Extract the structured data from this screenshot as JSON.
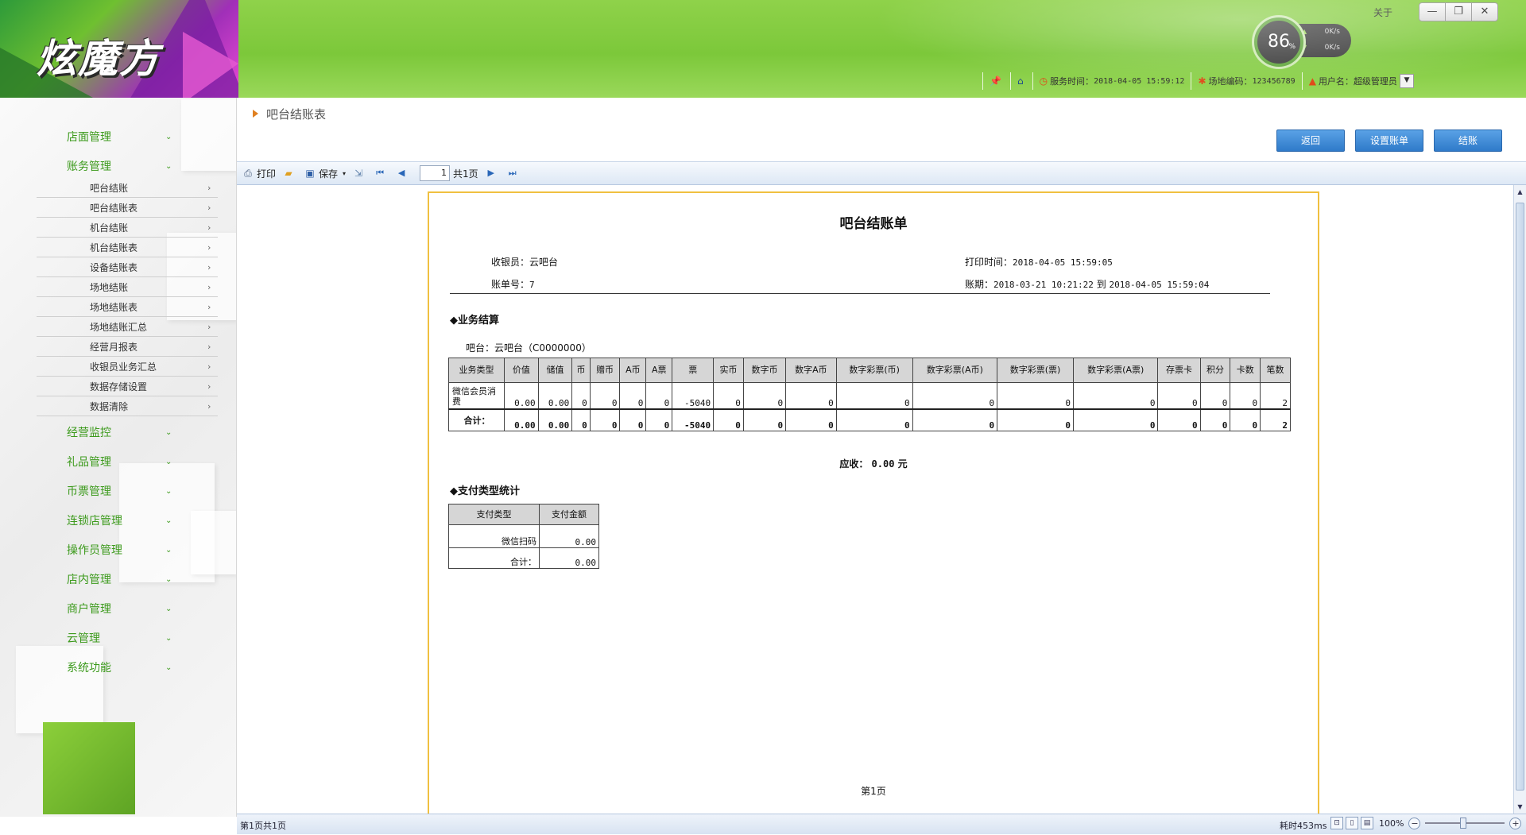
{
  "header": {
    "logo_text": "炫魔方",
    "gauge_value": "86",
    "gauge_unit": "%",
    "upload_speed": "0K/s",
    "download_speed": "0K/s",
    "about_label": "关于",
    "window_buttons": [
      "—",
      "❐",
      "✕"
    ],
    "service_time_label": "服务时间：",
    "service_time": "2018-04-05 15:59:12",
    "venue_code_label": "场地编码：",
    "venue_code": "123456789",
    "username_label": "用户名：",
    "username": "超级管理员"
  },
  "sidebar": {
    "menu": [
      {
        "label": "店面管理"
      },
      {
        "label": "账务管理"
      },
      {
        "label": "经营监控"
      },
      {
        "label": "礼品管理"
      },
      {
        "label": "币票管理"
      },
      {
        "label": "连锁店管理"
      },
      {
        "label": "操作员管理"
      },
      {
        "label": "店内管理"
      },
      {
        "label": "商户管理"
      },
      {
        "label": "云管理"
      },
      {
        "label": "系统功能"
      }
    ],
    "sub_items": [
      "吧台结账",
      "吧台结账表",
      "机台结账",
      "机台结账表",
      "设备结账表",
      "场地结账",
      "场地结账表",
      "场地结账汇总",
      "经营月报表",
      "收银员业务汇总",
      "数据存储设置",
      "数据清除"
    ]
  },
  "main": {
    "breadcrumb": "吧台结账表",
    "buttons": {
      "back": "返回",
      "set_account": "设置账单",
      "checkout": "结账"
    }
  },
  "toolbar": {
    "print": "打印",
    "save": "保存",
    "page_value": "1",
    "page_total": "共1页"
  },
  "report": {
    "title": "吧台结账单",
    "cashier_label": "收银员：",
    "cashier": "云吧台",
    "print_time_label": "打印时间：",
    "print_time": "2018-04-05 15:59:05",
    "bill_no_label": "账单号：",
    "bill_no": "7",
    "period_label": "账期：",
    "period_start": "2018-03-21 10:21:22",
    "period_to": "到",
    "period_end": "2018-04-05 15:59:04",
    "section1": "◆业务结算",
    "bar_line": "吧台：云吧台（C0000000）",
    "biz_headers": [
      "业务类型",
      "价值",
      "储值",
      "币",
      "赠币",
      "A币",
      "A票",
      "票",
      "实币",
      "数字币",
      "数字A币",
      "数字彩票(币)",
      "数字彩票(A币)",
      "数字彩票(票)",
      "数字彩票(A票)",
      "存票卡",
      "积分",
      "卡数",
      "笔数"
    ],
    "biz_rows": [
      [
        "微信会员消费",
        "0.00",
        "0.00",
        "0",
        "0",
        "0",
        "0",
        "-5040",
        "0",
        "0",
        "0",
        "0",
        "0",
        "0",
        "0",
        "0",
        "0",
        "0",
        "2"
      ]
    ],
    "biz_total": [
      "合计：",
      "0.00",
      "0.00",
      "0",
      "0",
      "0",
      "0",
      "-5040",
      "0",
      "0",
      "0",
      "0",
      "0",
      "0",
      "0",
      "0",
      "0",
      "0",
      "2"
    ],
    "receivable_label": "应收：",
    "receivable_value": "0.00",
    "receivable_unit": "元",
    "section2": "◆支付类型统计",
    "pay_headers": [
      "支付类型",
      "支付金额"
    ],
    "pay_rows": [
      [
        "微信扫码",
        "0.00"
      ]
    ],
    "pay_total": [
      "合计：",
      "0.00"
    ],
    "page_footer": "第1页"
  },
  "statusbar": {
    "page_info": "第1页共1页",
    "elapsed": "耗时453ms",
    "zoom": "100%"
  }
}
